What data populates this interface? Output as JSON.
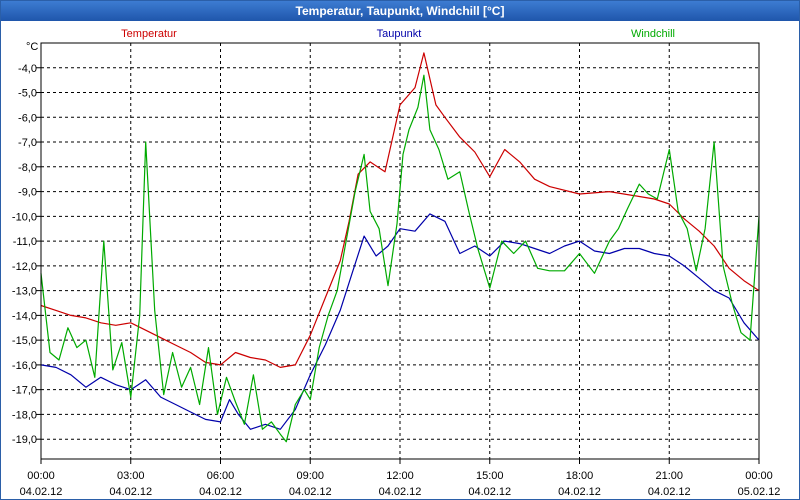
{
  "window": {
    "title": "Temperatur, Taupunkt, Windchill [°C]"
  },
  "chart_data": {
    "type": "line",
    "title": "Temperatur, Taupunkt, Windchill [°C]",
    "ylabel": "°C",
    "ylim": [
      -19.8,
      -3.0
    ],
    "yticks": [
      -4.0,
      -5.0,
      -6.0,
      -7.0,
      -8.0,
      -9.0,
      -10.0,
      -11.0,
      -12.0,
      -13.0,
      -14.0,
      -15.0,
      -16.0,
      -17.0,
      -18.0,
      -19.0
    ],
    "yticklabels": [
      "-4,0",
      "-5,0",
      "-6,0",
      "-7,0",
      "-8,0",
      "-9,0",
      "-10,0",
      "-11,0",
      "-12,0",
      "-13,0",
      "-14,0",
      "-15,0",
      "-16,0",
      "-17,0",
      "-18,0",
      "-19,0"
    ],
    "xlim": [
      0,
      24
    ],
    "xticks": [
      0,
      3,
      6,
      9,
      12,
      15,
      18,
      21,
      24
    ],
    "xticklabels": [
      {
        "time": "00:00",
        "date": "04.02.12"
      },
      {
        "time": "03:00",
        "date": "04.02.12"
      },
      {
        "time": "06:00",
        "date": "04.02.12"
      },
      {
        "time": "09:00",
        "date": "04.02.12"
      },
      {
        "time": "12:00",
        "date": "04.02.12"
      },
      {
        "time": "15:00",
        "date": "04.02.12"
      },
      {
        "time": "18:00",
        "date": "04.02.12"
      },
      {
        "time": "21:00",
        "date": "04.02.12"
      },
      {
        "time": "00:00",
        "date": "05.02.12"
      }
    ],
    "grid": true,
    "legend_position": "top",
    "series": [
      {
        "name": "Temperatur",
        "color": "#cc0000",
        "points": [
          [
            0,
            -13.6
          ],
          [
            0.5,
            -13.8
          ],
          [
            1,
            -14.0
          ],
          [
            1.5,
            -14.1
          ],
          [
            2,
            -14.3
          ],
          [
            2.5,
            -14.4
          ],
          [
            3,
            -14.3
          ],
          [
            3.5,
            -14.6
          ],
          [
            4,
            -14.9
          ],
          [
            4.5,
            -15.2
          ],
          [
            5,
            -15.5
          ],
          [
            5.5,
            -15.9
          ],
          [
            6,
            -16.0
          ],
          [
            6.5,
            -15.5
          ],
          [
            7,
            -15.7
          ],
          [
            7.5,
            -15.8
          ],
          [
            8,
            -16.1
          ],
          [
            8.5,
            -16.0
          ],
          [
            9,
            -14.8
          ],
          [
            9.5,
            -13.3
          ],
          [
            10,
            -11.8
          ],
          [
            10.3,
            -10.2
          ],
          [
            10.6,
            -8.3
          ],
          [
            11,
            -7.8
          ],
          [
            11.5,
            -8.2
          ],
          [
            12,
            -5.5
          ],
          [
            12.5,
            -4.8
          ],
          [
            12.8,
            -3.4
          ],
          [
            13.2,
            -5.5
          ],
          [
            13.5,
            -6.0
          ],
          [
            14,
            -6.8
          ],
          [
            14.5,
            -7.4
          ],
          [
            15,
            -8.4
          ],
          [
            15.5,
            -7.3
          ],
          [
            16,
            -7.8
          ],
          [
            16.5,
            -8.5
          ],
          [
            17,
            -8.8
          ],
          [
            18,
            -9.1
          ],
          [
            19,
            -9.0
          ],
          [
            20,
            -9.2
          ],
          [
            20.5,
            -9.3
          ],
          [
            21,
            -9.5
          ],
          [
            21.5,
            -10.1
          ],
          [
            22,
            -10.6
          ],
          [
            22.5,
            -11.2
          ],
          [
            23,
            -12.1
          ],
          [
            23.5,
            -12.6
          ],
          [
            24,
            -13.0
          ]
        ]
      },
      {
        "name": "Taupunkt",
        "color": "#0000aa",
        "points": [
          [
            0,
            -16.0
          ],
          [
            0.5,
            -16.1
          ],
          [
            1,
            -16.4
          ],
          [
            1.5,
            -16.9
          ],
          [
            2,
            -16.5
          ],
          [
            2.5,
            -16.8
          ],
          [
            3,
            -17.0
          ],
          [
            3.5,
            -16.6
          ],
          [
            4,
            -17.3
          ],
          [
            4.5,
            -17.6
          ],
          [
            5,
            -17.9
          ],
          [
            5.5,
            -18.2
          ],
          [
            6,
            -18.3
          ],
          [
            6.3,
            -17.4
          ],
          [
            6.6,
            -18.0
          ],
          [
            7,
            -18.6
          ],
          [
            7.5,
            -18.4
          ],
          [
            8,
            -18.6
          ],
          [
            8.5,
            -17.8
          ],
          [
            9,
            -16.4
          ],
          [
            9.5,
            -15.2
          ],
          [
            10,
            -13.8
          ],
          [
            10.4,
            -12.3
          ],
          [
            10.8,
            -10.8
          ],
          [
            11.2,
            -11.6
          ],
          [
            11.6,
            -11.2
          ],
          [
            12,
            -10.5
          ],
          [
            12.5,
            -10.6
          ],
          [
            13,
            -9.9
          ],
          [
            13.5,
            -10.2
          ],
          [
            14,
            -11.5
          ],
          [
            14.5,
            -11.2
          ],
          [
            15,
            -11.6
          ],
          [
            15.5,
            -11.0
          ],
          [
            16,
            -11.1
          ],
          [
            16.5,
            -11.3
          ],
          [
            17,
            -11.5
          ],
          [
            17.5,
            -11.2
          ],
          [
            18,
            -11.0
          ],
          [
            18.5,
            -11.4
          ],
          [
            19,
            -11.5
          ],
          [
            19.5,
            -11.3
          ],
          [
            20,
            -11.3
          ],
          [
            20.5,
            -11.5
          ],
          [
            21,
            -11.6
          ],
          [
            21.5,
            -12.0
          ],
          [
            22,
            -12.5
          ],
          [
            22.5,
            -13.0
          ],
          [
            23,
            -13.3
          ],
          [
            23.5,
            -14.3
          ],
          [
            24,
            -15.0
          ]
        ]
      },
      {
        "name": "Windchill",
        "color": "#00aa00",
        "points": [
          [
            0,
            -12.3
          ],
          [
            0.3,
            -15.5
          ],
          [
            0.6,
            -15.8
          ],
          [
            0.9,
            -14.5
          ],
          [
            1.2,
            -15.3
          ],
          [
            1.5,
            -15.0
          ],
          [
            1.8,
            -16.5
          ],
          [
            2.1,
            -11.0
          ],
          [
            2.4,
            -16.2
          ],
          [
            2.7,
            -15.1
          ],
          [
            3.0,
            -17.3
          ],
          [
            3.3,
            -14.0
          ],
          [
            3.5,
            -7.0
          ],
          [
            3.8,
            -13.8
          ],
          [
            4.1,
            -17.2
          ],
          [
            4.4,
            -15.5
          ],
          [
            4.7,
            -16.9
          ],
          [
            5.0,
            -16.1
          ],
          [
            5.3,
            -17.6
          ],
          [
            5.6,
            -15.3
          ],
          [
            5.9,
            -18.0
          ],
          [
            6.2,
            -16.5
          ],
          [
            6.5,
            -17.5
          ],
          [
            6.8,
            -18.4
          ],
          [
            7.1,
            -16.4
          ],
          [
            7.4,
            -18.6
          ],
          [
            7.7,
            -18.3
          ],
          [
            8.0,
            -18.8
          ],
          [
            8.2,
            -19.1
          ],
          [
            8.5,
            -17.6
          ],
          [
            8.8,
            -17.0
          ],
          [
            9.0,
            -17.4
          ],
          [
            9.3,
            -15.3
          ],
          [
            9.6,
            -14.0
          ],
          [
            9.9,
            -13.0
          ],
          [
            10.2,
            -11.0
          ],
          [
            10.5,
            -9.0
          ],
          [
            10.8,
            -7.5
          ],
          [
            11.0,
            -9.8
          ],
          [
            11.3,
            -10.5
          ],
          [
            11.6,
            -12.8
          ],
          [
            11.9,
            -10.3
          ],
          [
            12.1,
            -7.5
          ],
          [
            12.3,
            -6.5
          ],
          [
            12.6,
            -5.6
          ],
          [
            12.8,
            -4.3
          ],
          [
            13.0,
            -6.5
          ],
          [
            13.3,
            -7.3
          ],
          [
            13.6,
            -8.5
          ],
          [
            14.0,
            -8.2
          ],
          [
            14.3,
            -9.8
          ],
          [
            14.6,
            -11.3
          ],
          [
            15.0,
            -12.9
          ],
          [
            15.4,
            -11.0
          ],
          [
            15.8,
            -11.5
          ],
          [
            16.2,
            -11.0
          ],
          [
            16.6,
            -12.1
          ],
          [
            17.0,
            -12.2
          ],
          [
            17.5,
            -12.2
          ],
          [
            18.0,
            -11.5
          ],
          [
            18.5,
            -12.3
          ],
          [
            19.0,
            -11.0
          ],
          [
            19.3,
            -10.5
          ],
          [
            19.6,
            -9.7
          ],
          [
            20.0,
            -8.7
          ],
          [
            20.3,
            -9.1
          ],
          [
            20.6,
            -9.3
          ],
          [
            21.0,
            -7.3
          ],
          [
            21.3,
            -9.8
          ],
          [
            21.6,
            -10.5
          ],
          [
            21.9,
            -12.2
          ],
          [
            22.2,
            -10.5
          ],
          [
            22.5,
            -7.0
          ],
          [
            22.8,
            -12.0
          ],
          [
            23.1,
            -13.5
          ],
          [
            23.4,
            -14.7
          ],
          [
            23.7,
            -15.0
          ],
          [
            24.0,
            -10.0
          ]
        ]
      }
    ]
  }
}
